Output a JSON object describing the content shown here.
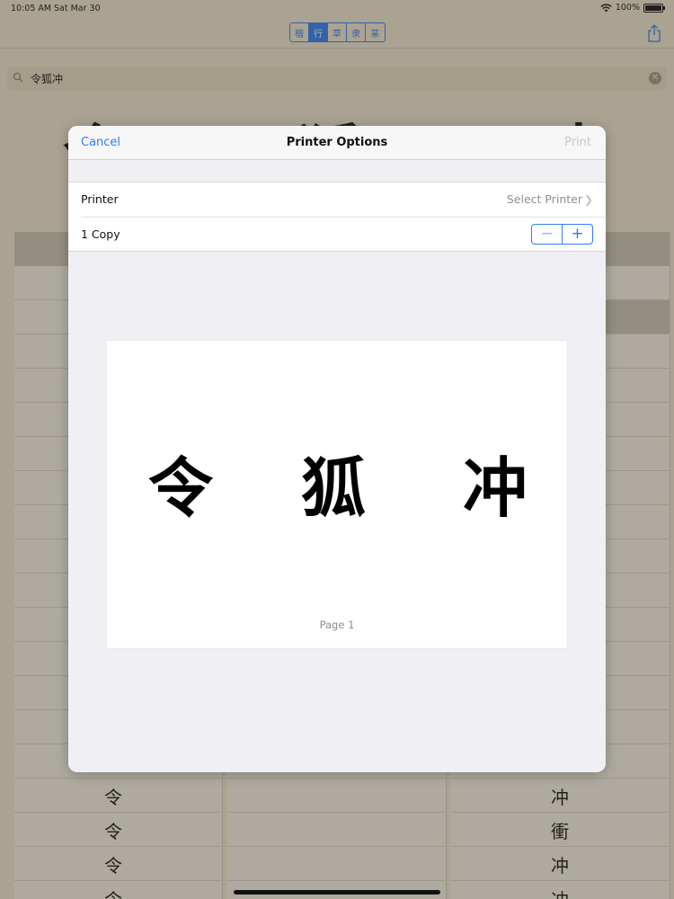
{
  "status_bar": {
    "time": "10:05 AM",
    "date": "Sat Mar 30",
    "battery": "100%"
  },
  "nav": {
    "segments": [
      {
        "label": "楷",
        "active": false
      },
      {
        "label": "行",
        "active": true
      },
      {
        "label": "草",
        "active": false
      },
      {
        "label": "隶",
        "active": false
      },
      {
        "label": "篆",
        "active": false
      }
    ],
    "share_icon": "share-icon"
  },
  "search": {
    "query": "令狐冲"
  },
  "background_chars": [
    "令",
    "狐",
    "冲"
  ],
  "column_glyphs": {
    "left": [
      "令",
      "令",
      "令",
      "令"
    ],
    "right": [
      "冲",
      "衝",
      "冲",
      "冲"
    ]
  },
  "dialog": {
    "title": "Printer Options",
    "cancel_label": "Cancel",
    "print_label": "Print",
    "printer_label": "Printer",
    "printer_value": "Select Printer",
    "copies_label": "1 Copy",
    "stepper_minus": "−",
    "stepper_plus": "+",
    "preview_chars": [
      "令",
      "狐",
      "冲"
    ],
    "page_label": "Page 1"
  },
  "colors": {
    "accent": "#2f7df6",
    "paper": "#efe6d0"
  }
}
